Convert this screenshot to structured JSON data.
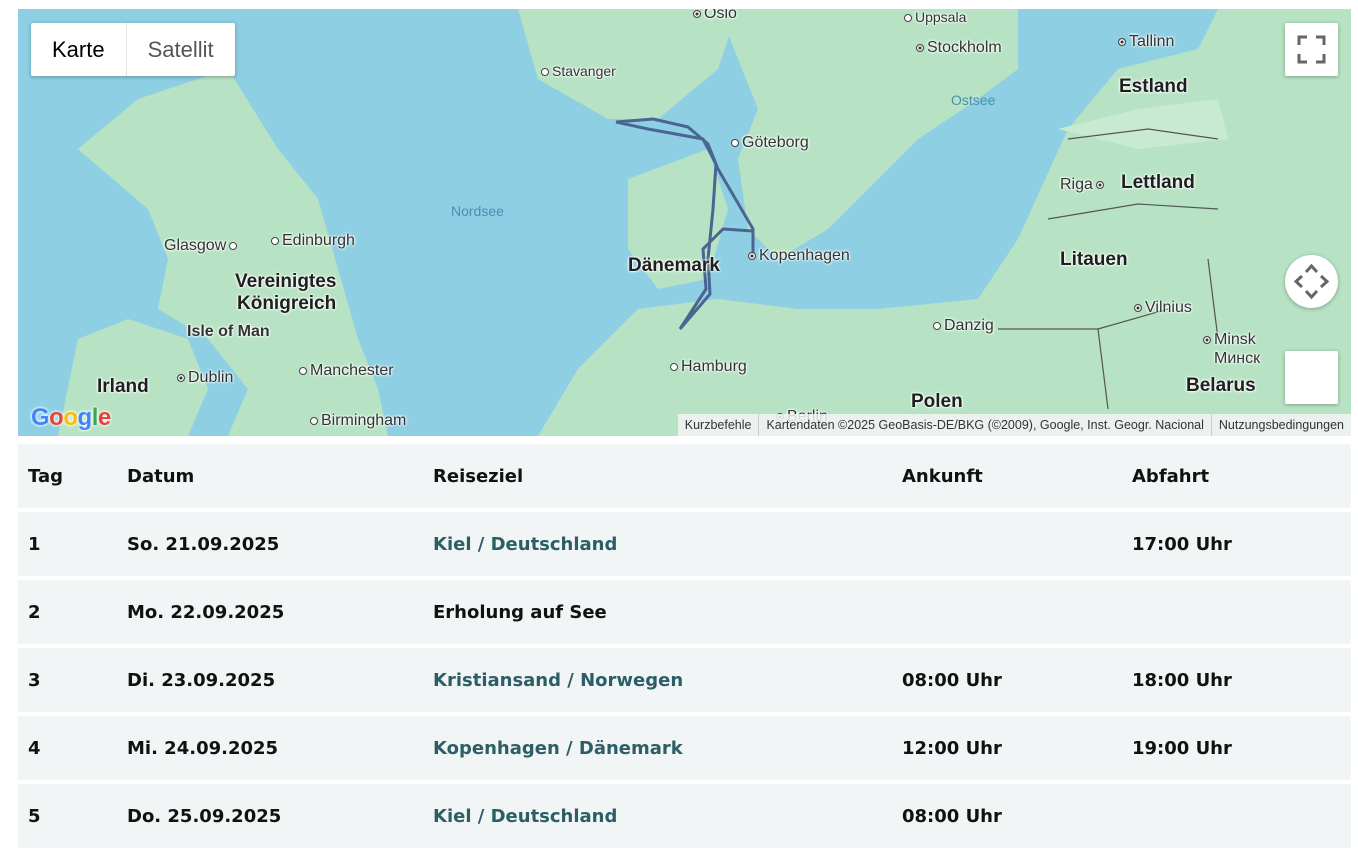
{
  "map": {
    "map_types": [
      "Karte",
      "Satellit"
    ],
    "selected_type": "Karte",
    "labels": {
      "oslo": "Oslo",
      "uppsala": "Uppsala",
      "stockholm": "Stockholm",
      "tallinn": "Tallinn",
      "stavanger": "Stavanger",
      "ostsee": "Ostsee",
      "estland": "Estland",
      "goteborg": "Göteborg",
      "riga": "Riga",
      "lettland": "Lettland",
      "nordsee": "Nordsee",
      "glasgow": "Glasgow",
      "edinburgh": "Edinburgh",
      "uk_line1": "Vereinigtes",
      "uk_line2": "Königreich",
      "daenemark": "Dänemark",
      "kopenhagen": "Kopenhagen",
      "litauen": "Litauen",
      "isle_of_man": "Isle of Man",
      "danzig": "Danzig",
      "vilnius": "Vilnius",
      "minsk": "Minsk",
      "minsk_cyr": "Минск",
      "irland": "Irland",
      "dublin": "Dublin",
      "manchester": "Manchester",
      "hamburg": "Hamburg",
      "belarus": "Belarus",
      "polen": "Polen",
      "birmingham": "Birmingham",
      "berlin": "Berlin"
    },
    "attribution": {
      "shortcuts": "Kurzbefehle",
      "data": "Kartendaten ©2025 GeoBasis-DE/BKG (©2009), Google, Inst. Geogr. Nacional",
      "terms": "Nutzungsbedingungen"
    },
    "logo": [
      "G",
      "o",
      "o",
      "g",
      "l",
      "e"
    ],
    "colors": {
      "water": "#8ecfe3",
      "land": "#b7e3c4",
      "route": "#4a6592"
    },
    "icons": [
      "fullscreen-icon",
      "pan-icon",
      "pegman-icon"
    ]
  },
  "table": {
    "headers": {
      "day": "Tag",
      "date": "Datum",
      "destination": "Reiseziel",
      "arrival": "Ankunft",
      "departure": "Abfahrt"
    },
    "rows": [
      {
        "day": "1",
        "date": "So. 21.09.2025",
        "destination": "Kiel / Deutschland",
        "arrival": "",
        "departure": "17:00 Uhr"
      },
      {
        "day": "2",
        "date": "Mo. 22.09.2025",
        "destination": "Erholung auf See",
        "arrival": "",
        "departure": ""
      },
      {
        "day": "3",
        "date": "Di. 23.09.2025",
        "destination": "Kristiansand / Norwegen",
        "arrival": "08:00 Uhr",
        "departure": "18:00 Uhr"
      },
      {
        "day": "4",
        "date": "Mi. 24.09.2025",
        "destination": "Kopenhagen / Dänemark",
        "arrival": "12:00 Uhr",
        "departure": "19:00 Uhr"
      },
      {
        "day": "5",
        "date": "Do. 25.09.2025",
        "destination": "Kiel / Deutschland",
        "arrival": "08:00 Uhr",
        "departure": ""
      }
    ]
  }
}
